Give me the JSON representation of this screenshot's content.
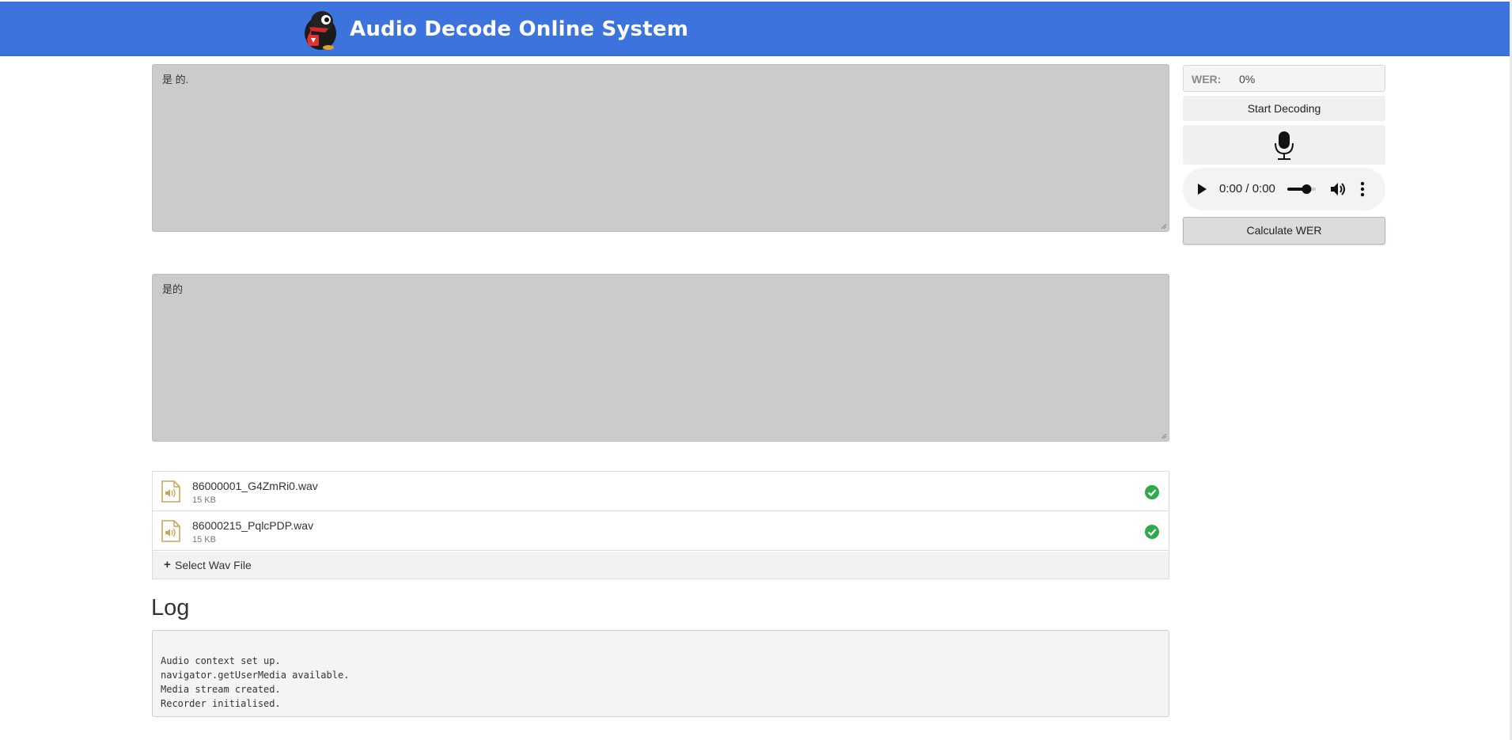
{
  "header": {
    "title": "Audio Decode Online System",
    "brand_color": "#3d73dd"
  },
  "transcripts": {
    "decoded_text": "是 的.",
    "reference_text": "是的"
  },
  "controls": {
    "wer_label": "WER:",
    "wer_value": "0%",
    "start_label": "Start Decoding",
    "calc_label": "Calculate WER",
    "mic_icon": "microphone-icon"
  },
  "audio_player": {
    "time": "0:00 / 0:00",
    "volume_fraction": 0.7
  },
  "files": [
    {
      "name": "86000001_G4ZmRi0.wav",
      "size": "15 KB",
      "status": "done"
    },
    {
      "name": "86000215_PqlcPDP.wav",
      "size": "15 KB",
      "status": "done"
    }
  ],
  "file_select_label": "Select Wav File",
  "log": {
    "title": "Log",
    "lines": [
      "Audio context set up.",
      "navigator.getUserMedia available.",
      "Media stream created.",
      "Recorder initialised."
    ]
  }
}
